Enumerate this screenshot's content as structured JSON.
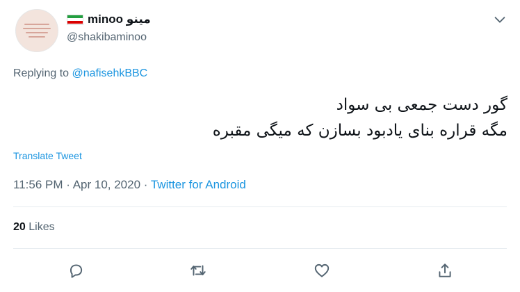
{
  "author": {
    "display_name": "minoo مینو",
    "handle": "@shakibaminoo",
    "flag_icon": "iran-flag-icon",
    "avatar_text": "avatar-image"
  },
  "reply": {
    "prefix": "Replying to ",
    "to": "@nafisehkBBC"
  },
  "tweet": {
    "lines": [
      "گور دست جمعی بی سواد",
      "مگه قراره بنای یادبود بسازن که میگی مقبره"
    ]
  },
  "translate_label": "Translate Tweet",
  "meta": {
    "time": "11:56 PM",
    "sep1": " · ",
    "date": "Apr 10, 2020",
    "sep2": " · ",
    "source": "Twitter for Android"
  },
  "stats": {
    "likes_count": "20",
    "likes_label": " Likes"
  },
  "colors": {
    "link": "#1b95e0",
    "secondary_text": "#536471",
    "flag_green": "#239f40",
    "flag_white": "#ffffff",
    "flag_red": "#da0000"
  },
  "actions": [
    "reply-icon",
    "retweet-icon",
    "like-icon",
    "share-icon"
  ]
}
